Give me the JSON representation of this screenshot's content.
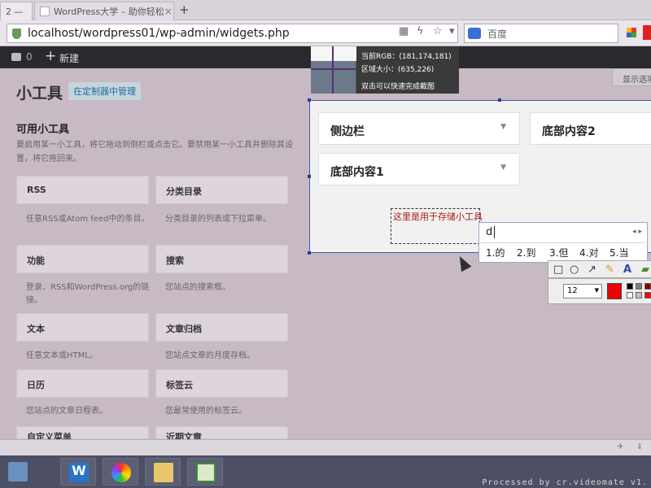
{
  "browser": {
    "tab_active_label": "2 —",
    "tab_two_label": "WordPress大学 – 助你轻松",
    "new_tab_symbol": "+",
    "url": "localhost/wordpress01/wp-admin/widgets.php",
    "search_engine": "百度"
  },
  "admin_bar": {
    "comment_count": "0",
    "new_label": "新建"
  },
  "page": {
    "title": "小工具",
    "manage_button": "在定制器中管理",
    "screen_options": "显示选项",
    "available_title": "可用小工具",
    "available_desc": "要启用某一小工具，将它拖动到侧栏或点击它。要禁用某一小工具并删除其设置，将它拖回来。"
  },
  "widgets": [
    {
      "title": "RSS",
      "desc": "任意RSS或Atom feed中的条目。"
    },
    {
      "title": "分类目录",
      "desc": "分类目录的列表或下拉菜单。"
    },
    {
      "title": "功能",
      "desc": "登录、RSS和WordPress.org的链接。"
    },
    {
      "title": "搜索",
      "desc": "您站点的搜索框。"
    },
    {
      "title": "文本",
      "desc": "任意文本或HTML。"
    },
    {
      "title": "文章归档",
      "desc": "您站点文章的月度存档。"
    },
    {
      "title": "日历",
      "desc": "您站点的文章日程表。"
    },
    {
      "title": "标签云",
      "desc": "您最常使用的标签云。"
    },
    {
      "title": "自定义菜单",
      "desc": ""
    },
    {
      "title": "近期文章",
      "desc": ""
    }
  ],
  "sidebars": [
    {
      "title": "侧边栏"
    },
    {
      "title": "底部内容2"
    },
    {
      "title": "底部内容1"
    }
  ],
  "capture_text": "这里是用于存储小工具",
  "magnifier": {
    "rgb_line": "当前RGB：(181,174,181)",
    "size_line": "区域大小：(635,226)",
    "hint_line": "双击可以快速完成截图"
  },
  "ime": {
    "input": "d",
    "candidates": [
      "1.的",
      "2.到",
      "3.但",
      "4.对",
      "5.当"
    ]
  },
  "capture_toolbar": {
    "font_size": "12",
    "current_color": "#ee0000",
    "swatches": [
      "#000000",
      "#808080",
      "#800000",
      "#ffffff",
      "#c0c0c0",
      "#ff0000"
    ]
  },
  "watermark": "Processed by cr.videomate v1.",
  "icons": [
    "comment-icon",
    "plus-icon",
    "shield-icon",
    "search-engine-icon",
    "apps-icon",
    "rectangle-tool-icon",
    "ellipse-tool-icon",
    "arrow-tool-icon",
    "brush-tool-icon",
    "text-tool-icon",
    "cursor-icon"
  ]
}
